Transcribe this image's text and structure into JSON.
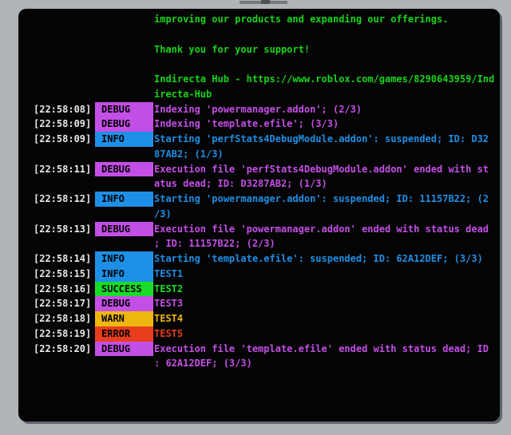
{
  "page": {
    "background": "#b0b3b7",
    "terminal_background": "#040404"
  },
  "banner": {
    "color": "#17d417",
    "lines": [
      "improving our products and expanding our offerings.",
      "",
      "Thank you for your support!",
      "",
      "Indirecta Hub - https://www.roblox.com/games/8290643959/Ind",
      "irecta-Hub"
    ]
  },
  "log": {
    "timestamp_color": "#e8e8e8",
    "level_colors": {
      "DEBUG": "#c44fe6",
      "INFO": "#1e8fe6",
      "SUCCESS": "#18dc28",
      "WARN": "#edb70f",
      "ERROR": "#e73d1d"
    },
    "entries": [
      {
        "time": "[22:58:08]",
        "level": "DEBUG",
        "lines": [
          "Indexing 'powermanager.addon'; (2/3)"
        ]
      },
      {
        "time": "[22:58:09]",
        "level": "DEBUG",
        "lines": [
          "Indexing 'template.efile'; (3/3)"
        ]
      },
      {
        "time": "[22:58:09]",
        "level": "INFO",
        "lines": [
          "Starting 'perfStats4DebugModule.addon': suspended; ID: D32",
          "87AB2; (1/3)"
        ]
      },
      {
        "time": "[22:58:11]",
        "level": "DEBUG",
        "lines": [
          "Execution file 'perfStats4DebugModule.addon' ended with st",
          "atus dead; ID: D3287AB2; (1/3)"
        ]
      },
      {
        "time": "[22:58:12]",
        "level": "INFO",
        "lines": [
          "Starting 'powermanager.addon': suspended; ID: 11157B22; (2",
          "/3)"
        ]
      },
      {
        "time": "[22:58:13]",
        "level": "DEBUG",
        "lines": [
          "Execution file 'powermanager.addon' ended with status dead",
          "; ID: 11157B22; (2/3)"
        ]
      },
      {
        "time": "[22:58:14]",
        "level": "INFO",
        "lines": [
          "Starting 'template.efile': suspended; ID: 62A12DEF; (3/3)"
        ]
      },
      {
        "time": "[22:58:15]",
        "level": "INFO",
        "lines": [
          "TEST1"
        ]
      },
      {
        "time": "[22:58:16]",
        "level": "SUCCESS",
        "lines": [
          "TEST2"
        ]
      },
      {
        "time": "[22:58:17]",
        "level": "DEBUG",
        "lines": [
          "TEST3"
        ]
      },
      {
        "time": "[22:58:18]",
        "level": "WARN",
        "lines": [
          "TEST4"
        ]
      },
      {
        "time": "[22:58:19]",
        "level": "ERROR",
        "lines": [
          "TEST5"
        ]
      },
      {
        "time": "[22:58:20]",
        "level": "DEBUG",
        "lines": [
          "Execution file 'template.efile' ended with status dead; ID",
          ": 62A12DEF; (3/3)"
        ]
      }
    ]
  }
}
